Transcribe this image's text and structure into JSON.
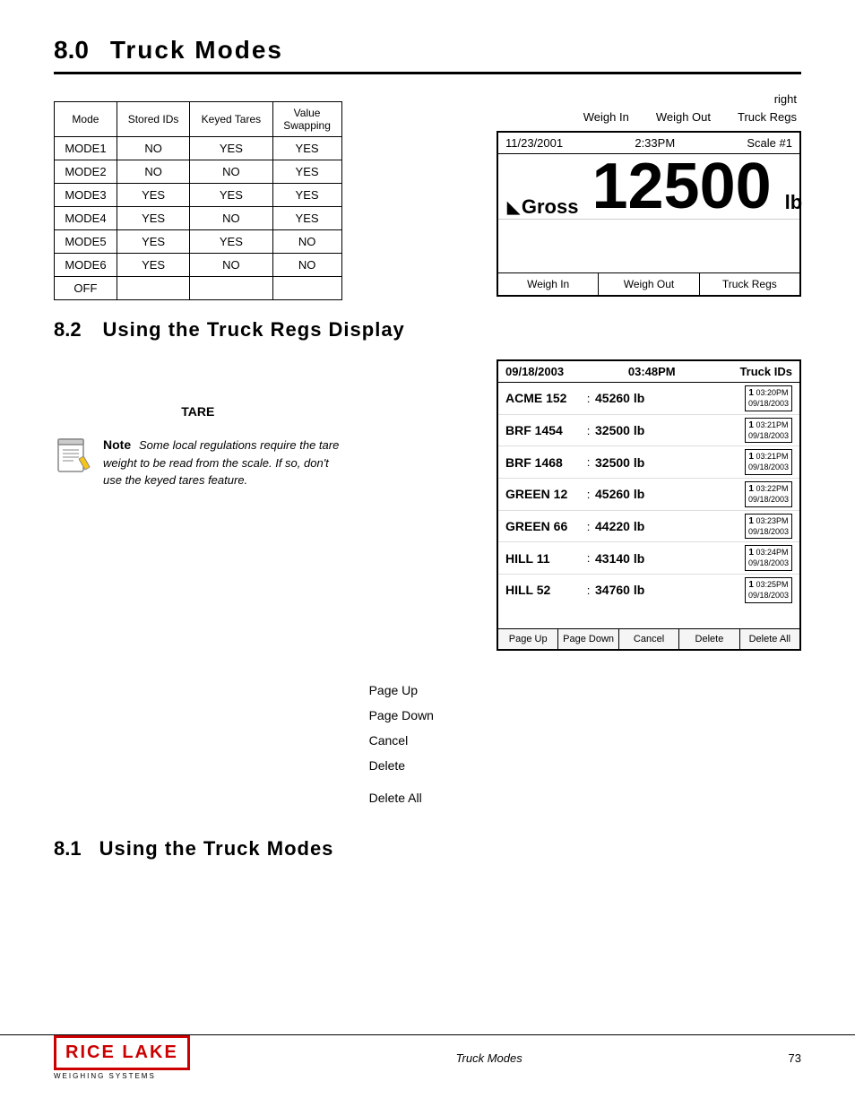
{
  "header": {
    "section": "8.0",
    "title": "Truck Modes"
  },
  "modeTable": {
    "columns": [
      "Mode",
      "Stored IDs",
      "Keyed Tares",
      "Value\nSwapping"
    ],
    "rows": [
      [
        "MODE1",
        "NO",
        "YES",
        "YES"
      ],
      [
        "MODE2",
        "NO",
        "NO",
        "YES"
      ],
      [
        "MODE3",
        "YES",
        "YES",
        "YES"
      ],
      [
        "MODE4",
        "YES",
        "NO",
        "YES"
      ],
      [
        "MODE5",
        "YES",
        "YES",
        "NO"
      ],
      [
        "MODE6",
        "YES",
        "NO",
        "NO"
      ],
      [
        "OFF",
        "",
        "",
        ""
      ]
    ]
  },
  "scaleDisplay": {
    "date": "11/23/2001",
    "time": "2:33PM",
    "scale": "Scale #1",
    "weight": "12500",
    "gross": "Gross",
    "unit": "lb",
    "buttons": [
      "Weigh In",
      "Weigh Out",
      "Truck Regs"
    ]
  },
  "rightLabels": [
    "right",
    "Weigh In",
    "Weigh Out",
    "Truck Regs"
  ],
  "section82": {
    "number": "8.2",
    "title": "Using the Truck Regs Display"
  },
  "truckRegsDisplay": {
    "date": "09/18/2003",
    "time": "03:48PM",
    "label": "Truck IDs",
    "rows": [
      {
        "name": "ACME 152",
        "weight": "45260 lb",
        "ts_num": "1",
        "ts_time": "03:20PM",
        "ts_date": "09/18/2003"
      },
      {
        "name": "BRF 1454",
        "weight": "32500 lb",
        "ts_num": "1",
        "ts_time": "03:21PM",
        "ts_date": "09/18/2003"
      },
      {
        "name": "BRF 1468",
        "weight": "32500 lb",
        "ts_num": "1",
        "ts_time": "03:21PM",
        "ts_date": "09/18/2003"
      },
      {
        "name": "GREEN 12",
        "weight": "45260 lb",
        "ts_num": "1",
        "ts_time": "03:22PM",
        "ts_date": "09/18/2003"
      },
      {
        "name": "GREEN 66",
        "weight": "44220 lb",
        "ts_num": "1",
        "ts_time": "03:23PM",
        "ts_date": "09/18/2003"
      },
      {
        "name": "HILL 11",
        "weight": "43140 lb",
        "ts_num": "1",
        "ts_time": "03:24PM",
        "ts_date": "09/18/2003"
      },
      {
        "name": "HILL 52",
        "weight": "34760 lb",
        "ts_num": "1",
        "ts_time": "03:25PM",
        "ts_date": "09/18/2003"
      }
    ],
    "buttons": [
      "Page Up",
      "Page Down",
      "Cancel",
      "Delete",
      "Delete All"
    ]
  },
  "tare": "TARE",
  "note": {
    "label": "Note",
    "text": "Some local regulations require the tare weight to be read from the scale. If so, don't use the keyed tares feature."
  },
  "buttonLabels": {
    "pageUp": "Page Up",
    "pageDown": "Page Down",
    "cancel": "Cancel",
    "delete": "Delete",
    "deleteAll": "Delete All"
  },
  "section81": {
    "number": "8.1",
    "title": "Using the Truck Modes"
  },
  "footer": {
    "logoLine1": "RICE LAKE",
    "logoLine2": "WEIGHING SYSTEMS",
    "chapter": "Truck Modes",
    "page": "73"
  }
}
